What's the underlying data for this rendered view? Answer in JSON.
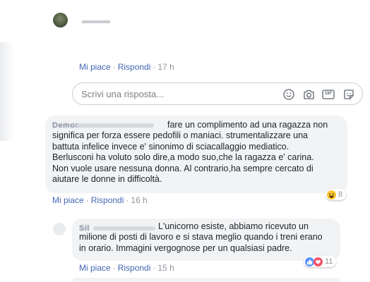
{
  "top_reply": {
    "author_redacted": "......",
    "actions": {
      "like": "Mi piace",
      "reply": "Rispondi",
      "time": "17 h"
    }
  },
  "composer": {
    "placeholder": "Scrivi una risposta...",
    "icons": [
      "emoji-icon",
      "camera-icon",
      "gif-icon",
      "sticker-icon"
    ],
    "gif_label": "GIF"
  },
  "comment_1": {
    "author_partial": "Demon",
    "lines": [
      "fare un complimento ad una ragazza non",
      "significa per forza essere pedofili o maniaci. strumentalizzare una",
      "battuta infelice invece e' sinonimo di sciacallaggio mediatico.",
      "Berlusconi ha voluto solo dire,a modo suo,che la ragazza e' carina.",
      "Non vuole usare nessuna donna. Al contrario,ha sempre cercato di",
      "aiutare le donne in difficoltà."
    ],
    "reaction_icon": "haha",
    "reaction_count": "8",
    "actions": {
      "like": "Mi piace",
      "reply": "Rispondi",
      "time": "16 h"
    }
  },
  "comment_2": {
    "author_partial": "Sil",
    "lines": [
      "L'unicorno esiste, abbiamo ricevuto un",
      "milione di posti di lavoro e si stava meglio quando i treni erano",
      "in orario. Immagini vergognose per un qualsiasi padre."
    ],
    "reaction_icons": [
      "like",
      "love"
    ],
    "reaction_count": "11",
    "actions": {
      "like": "Mi piace",
      "reply": "Rispondi",
      "time": "15 h"
    }
  },
  "colors": {
    "link": "#4267b2",
    "bubble": "#f2f3f5",
    "muted": "#90949c",
    "like_blue": "#5890ff",
    "love_red": "#f25268",
    "haha_yellow": "#fcc934"
  }
}
